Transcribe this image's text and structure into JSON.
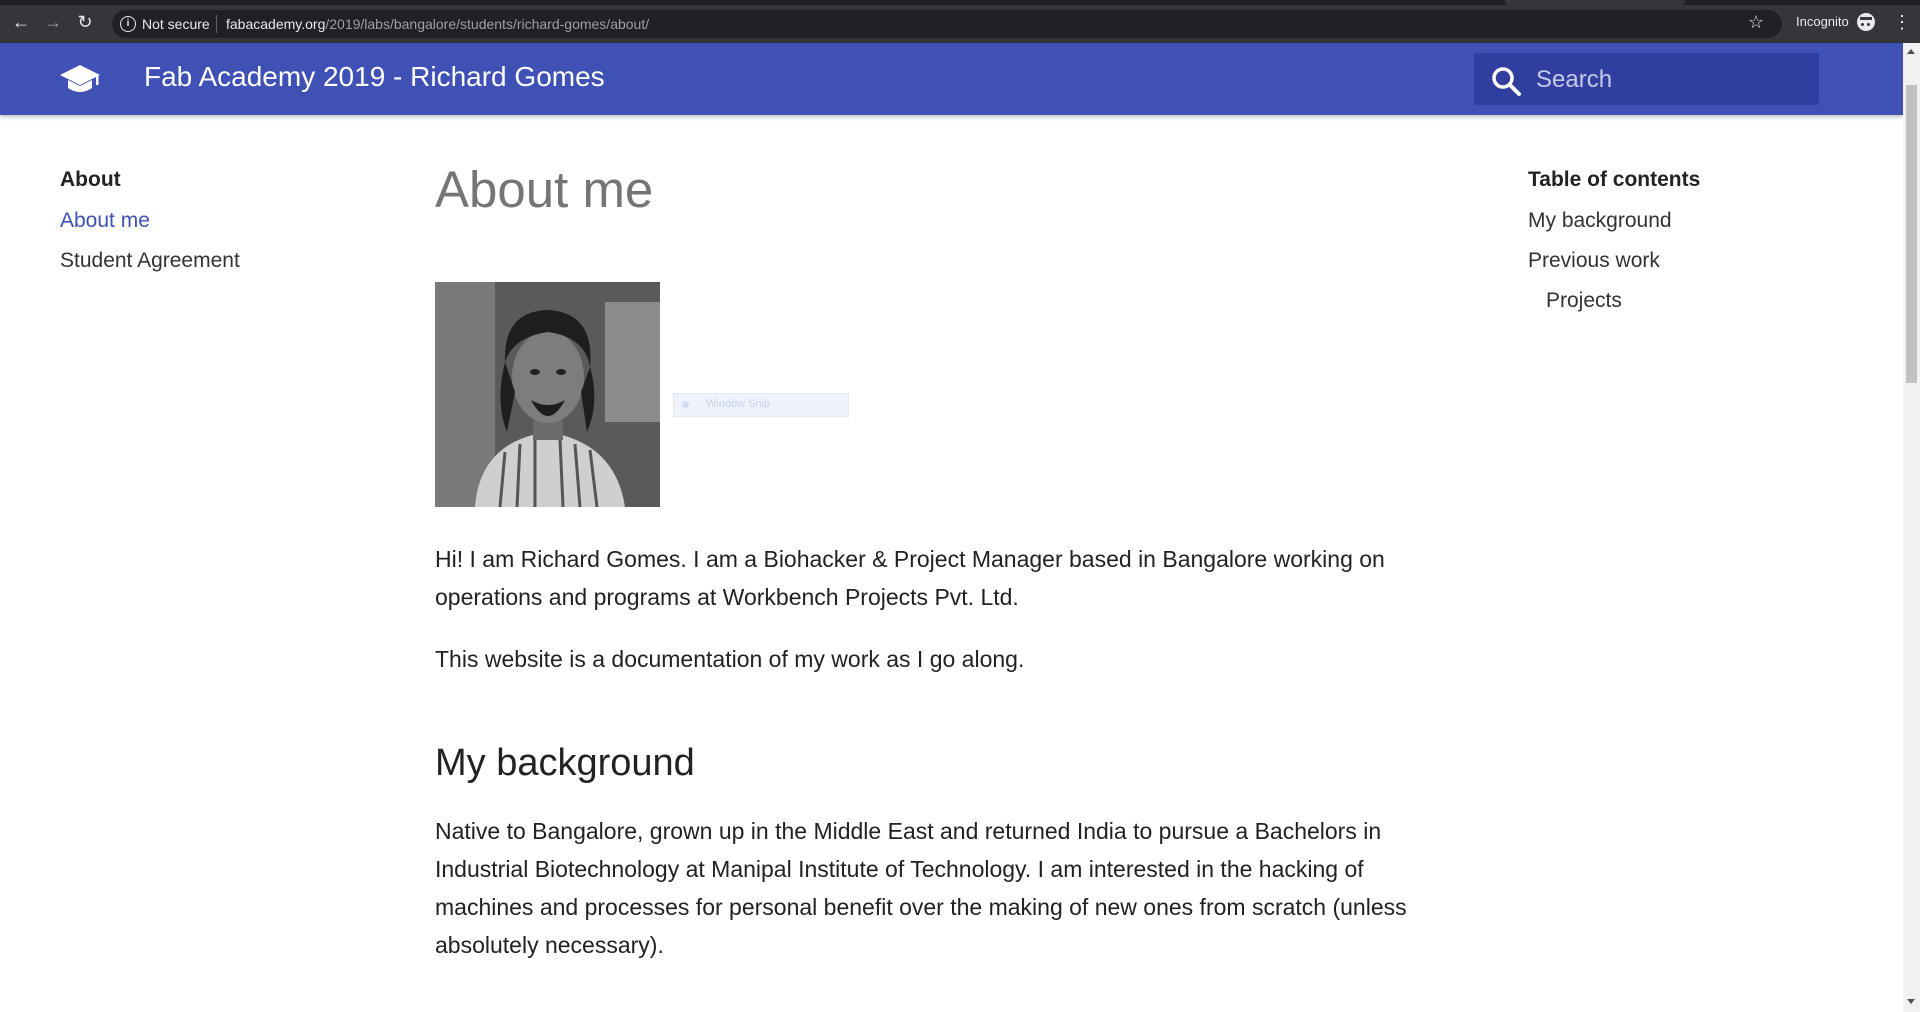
{
  "browser": {
    "security_label": "Not secure",
    "url_host": "fabacademy.org",
    "url_path": "/2019/labs/bangalore/students/richard-gomes/about/",
    "incognito_label": "Incognito",
    "icons": [
      "back-arrow-icon",
      "forward-arrow-icon",
      "reload-icon",
      "info-icon",
      "star-icon",
      "incognito-icon",
      "more-vert-icon"
    ]
  },
  "header": {
    "title": "Fab Academy 2019 - Richard Gomes",
    "search_placeholder": "Search",
    "brand_color": "#3f51b5",
    "search_bg": "#303f9f"
  },
  "sidebar": {
    "title": "About",
    "items": [
      {
        "label": "About me",
        "active": true
      },
      {
        "label": "Student Agreement",
        "active": false
      }
    ]
  },
  "main": {
    "title": "About me",
    "snip_label": "Window Snip",
    "intro": "Hi! I am Richard Gomes. I am a Biohacker & Project Manager based in Bangalore working on operations and programs at Workbench Projects Pvt. Ltd.",
    "note": "This website is a documentation of my work as I go along.",
    "section_heading": "My background",
    "background": "Native to Bangalore, grown up in the Middle East and returned India to pursue a Bachelors in Industrial Biotechnology at Manipal Institute of Technology. I am interested in the hacking of machines and processes for personal benefit over the making of new ones from scratch (unless absolutely necessary)."
  },
  "toc": {
    "title": "Table of contents",
    "items": [
      {
        "label": "My background"
      },
      {
        "label": "Previous work"
      },
      {
        "label": "Projects"
      }
    ]
  }
}
